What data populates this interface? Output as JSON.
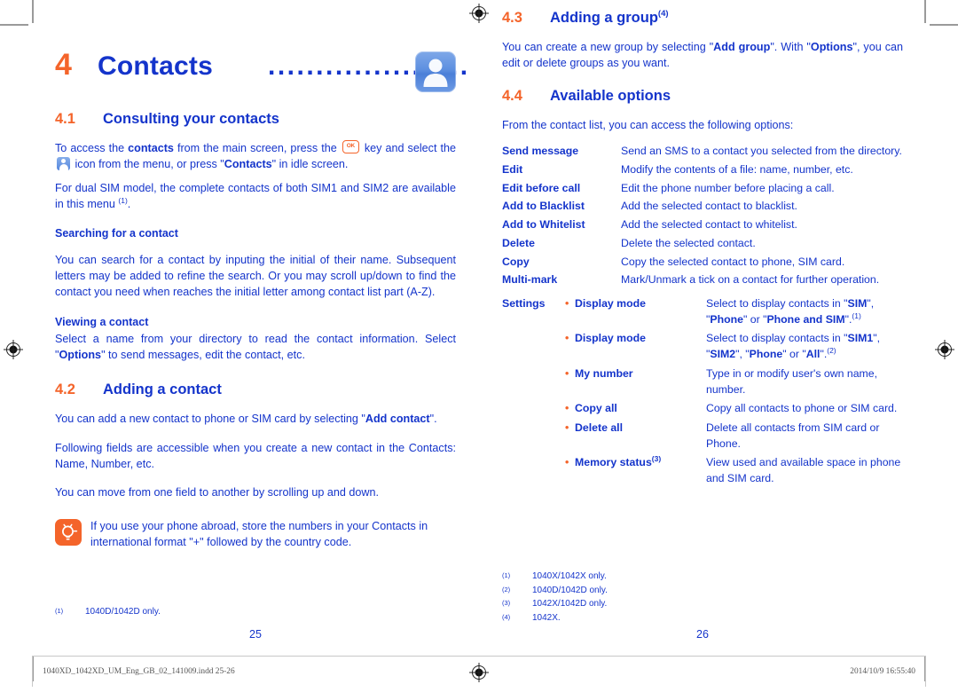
{
  "document": {
    "chapter_number": "4",
    "chapter_title": "Contacts",
    "dots": "............................",
    "chapter_icon": "contacts-person-icon"
  },
  "left_column": {
    "section_41": {
      "number": "4.1",
      "title": "Consulting your contacts",
      "paragraphs": {
        "p1_a": "To access the ",
        "p1_b": "contacts",
        "p1_c": " from the main screen, press the ",
        "p1_d": " key and select the ",
        "p1_e": " icon from the menu, or press \"",
        "p1_f": "Contacts",
        "p1_g": "\" in idle screen.",
        "p2": "For dual SIM model, the complete contacts of both SIM1 and SIM2 are available in this menu ",
        "p2_sup": "(1)",
        "p2_end": "."
      },
      "sub_searching": {
        "heading": "Searching for a contact",
        "text": "You can search for a contact by inputing the initial of their name. Subsequent letters may be added to refine the search. Or you may scroll up/down to find the contact you need when reaches the initial letter among contact list part (A-Z)."
      },
      "sub_viewing": {
        "heading": "Viewing a contact",
        "text_a": "Select a name from your directory to read the contact information. Select \"",
        "text_b": "Options",
        "text_c": "\" to send messages, edit the contact, etc."
      }
    },
    "section_42": {
      "number": "4.2",
      "title": "Adding a contact",
      "p1_a": "You can add a new contact to phone or SIM card by selecting \"",
      "p1_b": "Add contact",
      "p1_c": "\".",
      "p2": "Following fields are accessible when you create a new contact in the Contacts: Name, Number, etc.",
      "p3": "You can move from one field to another by scrolling up and down."
    },
    "tip": {
      "icon": "lightbulb-icon",
      "text": "If you use your phone abroad, store the numbers in your Contacts in international format \"+\" followed by the country code."
    },
    "footnotes": [
      {
        "mark": "(1)",
        "text": "1040D/1042D only."
      }
    ],
    "page_number": "25"
  },
  "right_column": {
    "section_43": {
      "number": "4.3",
      "title": "Adding a group",
      "sup": "(4)",
      "p1_a": "You can create a new group by selecting \"",
      "p1_b": "Add group",
      "p1_c": "\". With \"",
      "p1_d": "Options",
      "p1_e": "\", you can edit or delete groups as you want."
    },
    "section_44": {
      "number": "4.4",
      "title": "Available options",
      "intro": "From the contact list, you can access the following options:",
      "options": [
        {
          "term": "Send message",
          "definition": "Send an SMS to a contact you selected from the directory."
        },
        {
          "term": "Edit",
          "definition": "Modify the contents of a file: name, number, etc."
        },
        {
          "term": "Edit before call",
          "definition": "Edit the phone number before placing a call."
        },
        {
          "term": "Add to Blacklist",
          "definition": "Add the selected contact to blacklist."
        },
        {
          "term": "Add to Whitelist",
          "definition": "Add the selected contact to whitelist."
        },
        {
          "term": "Delete",
          "definition": "Delete the selected contact."
        },
        {
          "term": "Copy",
          "definition": "Copy the selected contact to phone, SIM card."
        },
        {
          "term": "Multi-mark",
          "definition": "Mark/Unmark a tick on a contact for further operation."
        }
      ],
      "settings": {
        "label": "Settings",
        "items": [
          {
            "term": "Display mode",
            "def_a": "Select to display contacts in \"",
            "def_b": "SIM",
            "def_c": "\", \"",
            "def_d": "Phone",
            "def_e": "\" or \"",
            "def_f": "Phone and SIM",
            "def_g": "\".",
            "sup": "(1)"
          },
          {
            "term": "Display mode",
            "def_a": "Select to display contacts in \"",
            "def_b": "SIM1",
            "def_c": "\", \"",
            "def_d": "SIM2",
            "def_e": "\", \"",
            "def_f": "Phone",
            "def_g": "\" or \"",
            "def_h": "All",
            "def_i": "\".",
            "sup": "(2)"
          },
          {
            "term": "My number",
            "definition": "Type in or modify user's own name, number."
          },
          {
            "term": "Copy all",
            "definition": "Copy all contacts to phone or SIM card."
          },
          {
            "term": "Delete all",
            "definition": "Delete all contacts from SIM card or Phone."
          },
          {
            "term": "Memory status",
            "sup": "(3)",
            "definition": "View used and available space in phone and SIM card."
          }
        ]
      }
    },
    "footnotes": [
      {
        "mark": "(1)",
        "text": "1040X/1042X only."
      },
      {
        "mark": "(2)",
        "text": "1040D/1042D only."
      },
      {
        "mark": "(3)",
        "text": "1042X/1042D only."
      },
      {
        "mark": "(4)",
        "text": "1042X."
      }
    ],
    "page_number": "26"
  },
  "print_bar": {
    "filename": "1040XD_1042XD_UM_Eng_GB_02_141009.indd   25-26",
    "timestamp": "2014/10/9   16:55:40",
    "registration_icon": "registration-target-icon"
  },
  "colors": {
    "brand_blue": "#1434CB",
    "brand_orange": "#F4642A",
    "mark_gray": "#9a9a9a"
  }
}
